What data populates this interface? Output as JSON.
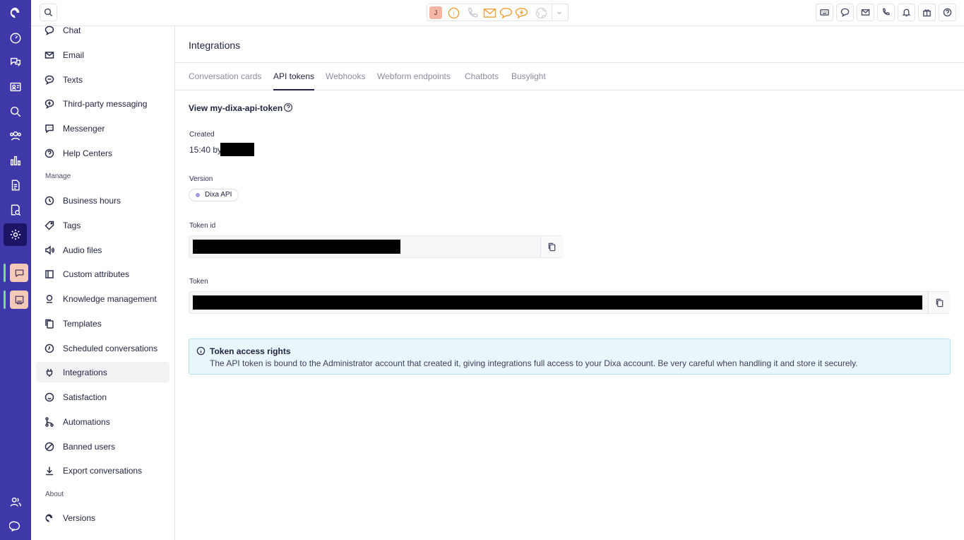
{
  "topbar": {
    "avatar_initial": "J",
    "status_initial": "!"
  },
  "sidebar": {
    "items": [
      {
        "label": "Chat",
        "icon": "chat-bubble-icon"
      },
      {
        "label": "Email",
        "icon": "envelope-icon"
      },
      {
        "label": "Texts",
        "icon": "sms-bubble-icon"
      },
      {
        "label": "Third-party messaging",
        "icon": "chat-bubble-icon"
      },
      {
        "label": "Messenger",
        "icon": "messenger-icon"
      },
      {
        "label": "Help Centers",
        "icon": "question-circle-icon"
      }
    ],
    "manage_heading": "Manage",
    "manage_items": [
      {
        "label": "Business hours",
        "icon": "clock-icon"
      },
      {
        "label": "Tags",
        "icon": "tag-icon"
      },
      {
        "label": "Audio files",
        "icon": "speaker-icon"
      },
      {
        "label": "Custom attributes",
        "icon": "panel-icon"
      },
      {
        "label": "Knowledge management",
        "icon": "lightbulb-icon"
      },
      {
        "label": "Templates",
        "icon": "copy-icon"
      },
      {
        "label": "Scheduled conversations",
        "icon": "clock-icon"
      },
      {
        "label": "Integrations",
        "icon": "plug-icon"
      },
      {
        "label": "Satisfaction",
        "icon": "smiley-icon"
      },
      {
        "label": "Automations",
        "icon": "flow-icon"
      },
      {
        "label": "Banned users",
        "icon": "ban-icon"
      },
      {
        "label": "Export conversations",
        "icon": "download-icon"
      }
    ],
    "about_heading": "About",
    "about_items": [
      {
        "label": "Versions",
        "icon": "dixa-logo-icon"
      }
    ]
  },
  "main": {
    "title": "Integrations",
    "tabs": [
      {
        "label": "Conversation cards",
        "active": false
      },
      {
        "label": "API tokens",
        "active": true
      },
      {
        "label": "Webhooks",
        "active": false
      },
      {
        "label": "Webform endpoints",
        "active": false
      },
      {
        "label": "Chatbots",
        "active": false
      },
      {
        "label": "Busylight",
        "active": false
      }
    ],
    "view_title": "View my-dixa-api-token",
    "created_label": "Created",
    "created_value": "15:40 by",
    "version_label": "Version",
    "version_value": "Dixa API",
    "token_id_label": "Token id",
    "token_label": "Token",
    "info": {
      "title": "Token access rights",
      "text": "The API token is bound to the Administrator account that created it, giving integrations full access to your Dixa account. Be very careful when handling it and store it securely."
    }
  },
  "colors": {
    "rail": "#3f38a8",
    "rail_active": "#1c1566",
    "accent_orange": "#f0a23a",
    "info_bg": "#eaf6fc",
    "info_border": "#b8dff0"
  }
}
